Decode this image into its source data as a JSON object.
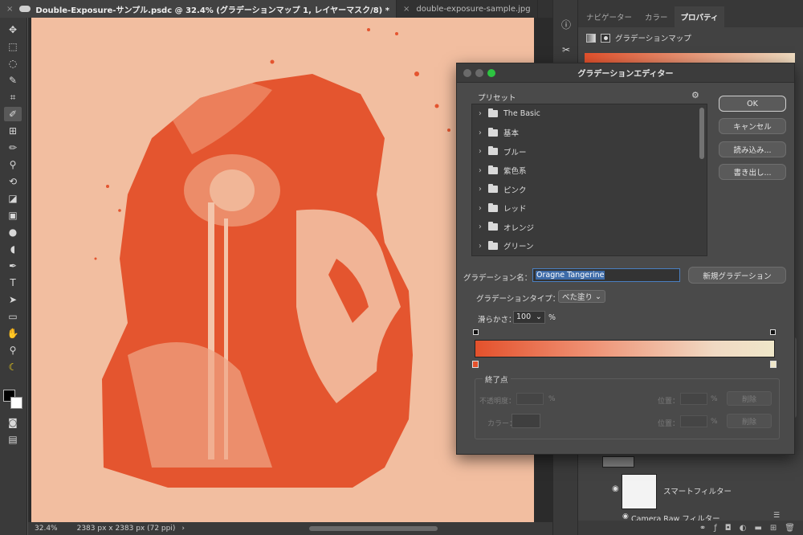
{
  "tabs": [
    {
      "label": "Double-Exposure-サンプル.psdc @ 32.4% (グラデーションマップ 1, レイヤーマスク/8) *",
      "close": "×"
    },
    {
      "label": "double-exposure-sample.jpg",
      "close": "×"
    }
  ],
  "status": {
    "zoom": "32.4%",
    "doc_info": "2383 px x 2383 px (72 ppi)",
    "arrow": "›"
  },
  "panels": {
    "tabs": [
      "ナビゲーター",
      "カラー",
      "プロパティ"
    ],
    "properties_title": "グラデーションマップ",
    "smart_filter_label": "スマートフィルター",
    "camera_raw_label": "Camera Raw フィルター"
  },
  "dialog": {
    "title": "グラデーションエディター",
    "presets_label": "プリセット",
    "presets": [
      "The Basic",
      "基本",
      "ブルー",
      "紫色系",
      "ピンク",
      "レッド",
      "オレンジ",
      "グリーン"
    ],
    "buttons": {
      "ok": "OK",
      "cancel": "キャンセル",
      "load": "読み込み...",
      "save": "書き出し..."
    },
    "name_label": "グラデーション名：",
    "name_value": "Oragne Tangerine",
    "new_gradient": "新規グラデーション",
    "type_label": "グラデーションタイプ：",
    "type_value": "べた塗り",
    "smoothness_label": "滑らかさ：",
    "smoothness_value": "100",
    "percent": "%",
    "stops_legend": "終了点",
    "opacity_label": "不透明度：",
    "color_label": "カラー：",
    "location_label": "位置：",
    "delete_label": "削除",
    "gradient_colors": {
      "start": "#e4512c",
      "end": "#efe7c9"
    }
  }
}
